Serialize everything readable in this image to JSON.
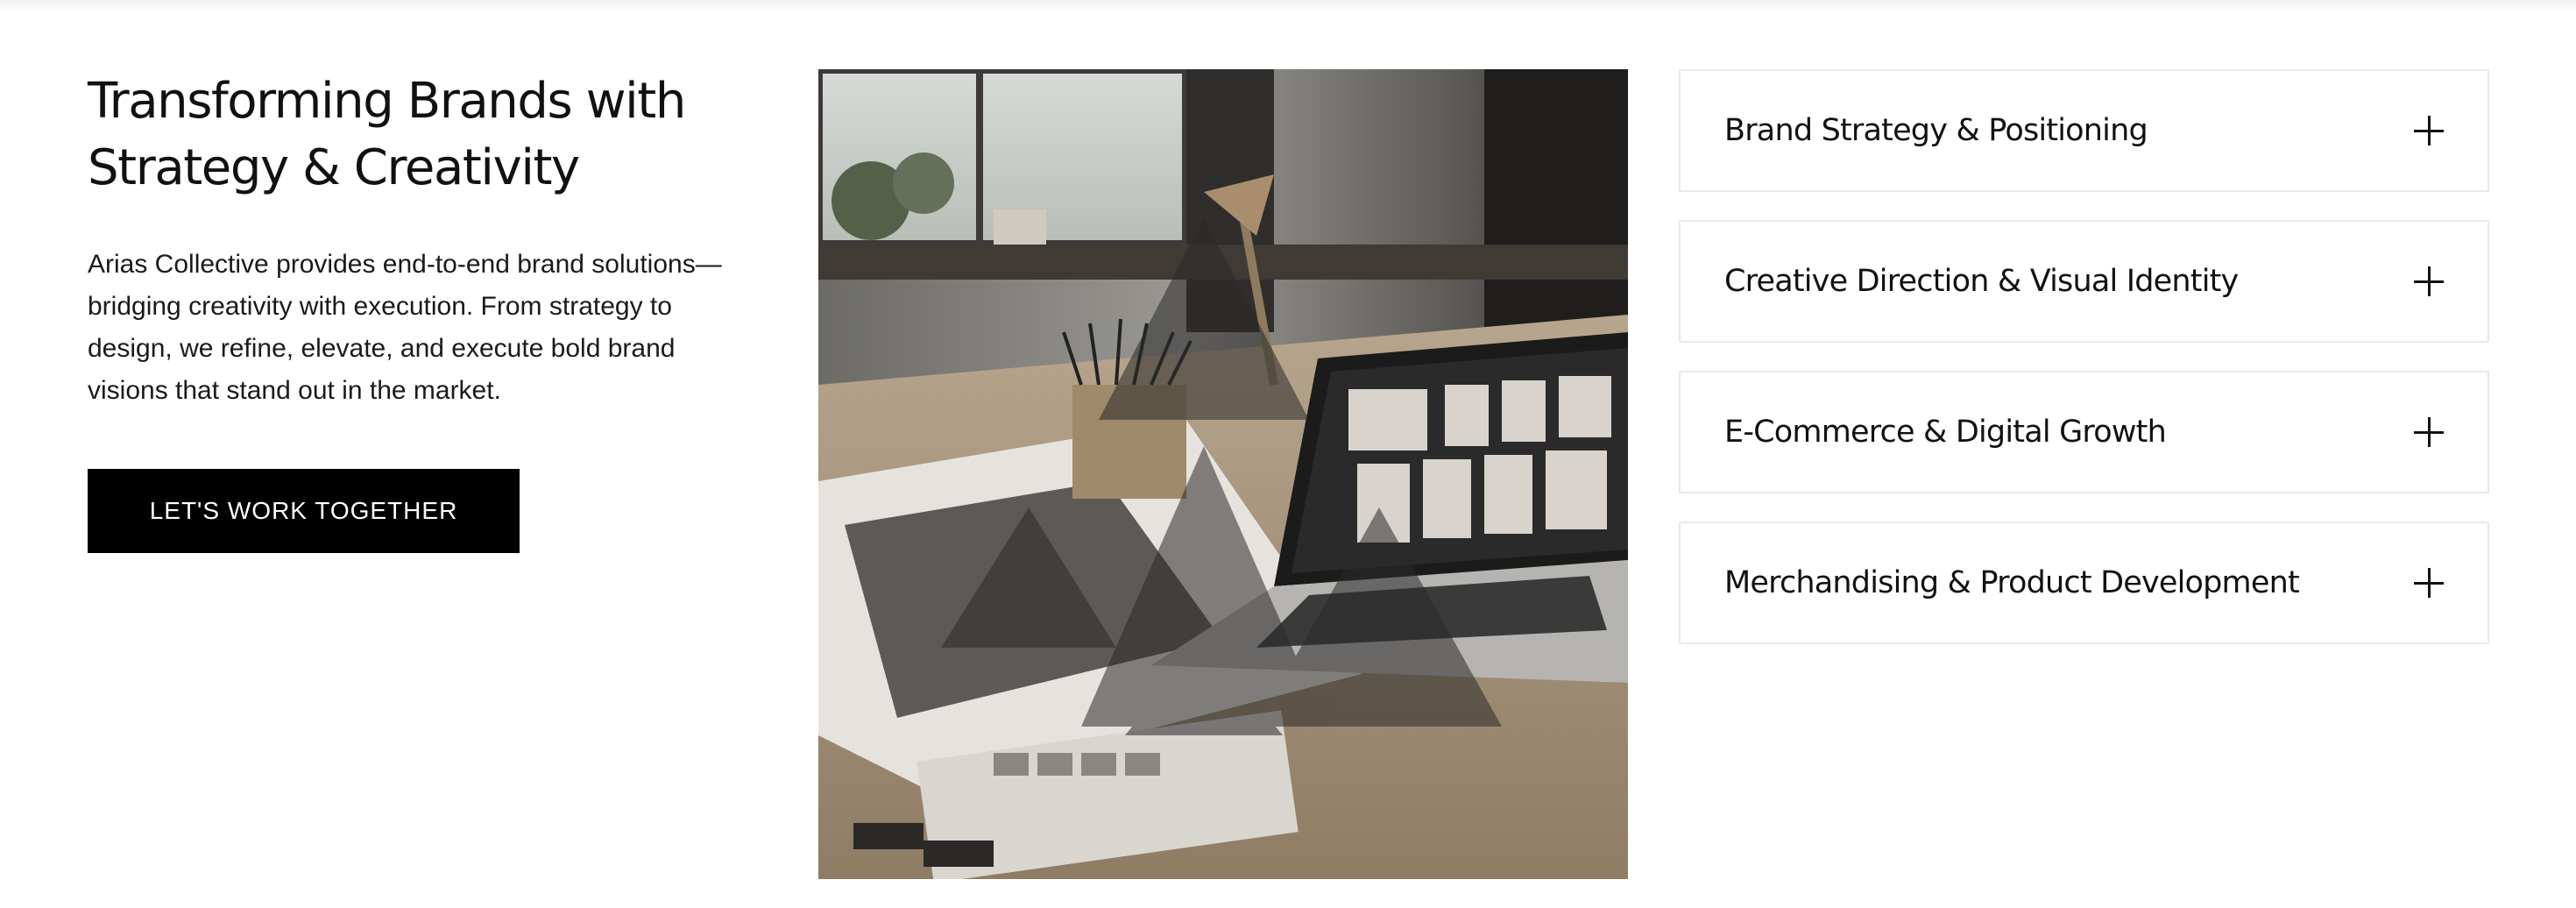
{
  "intro": {
    "heading_line1": "Transforming Brands with",
    "heading_line2": "Strategy & Creativity",
    "description": "Arias Collective provides end-to-end brand solutions—bridging creativity with execution. From strategy to design, we refine, elevate, and execute bold brand visions that stand out in the market."
  },
  "cta": {
    "label": "LET'S WORK TOGETHER"
  },
  "hero_image": {
    "alt": "Designer workspace with laptop and brand materials"
  },
  "services": {
    "items": [
      {
        "label": "Brand Strategy & Positioning",
        "icon": "plus-icon"
      },
      {
        "label": "Creative Direction & Visual Identity",
        "icon": "plus-icon"
      },
      {
        "label": "E-Commerce & Digital Growth",
        "icon": "plus-icon"
      },
      {
        "label": "Merchandising & Product Development",
        "icon": "plus-icon"
      }
    ]
  },
  "colors": {
    "button_bg": "#000000",
    "border": "#e9e9e9",
    "text": "#111111"
  }
}
